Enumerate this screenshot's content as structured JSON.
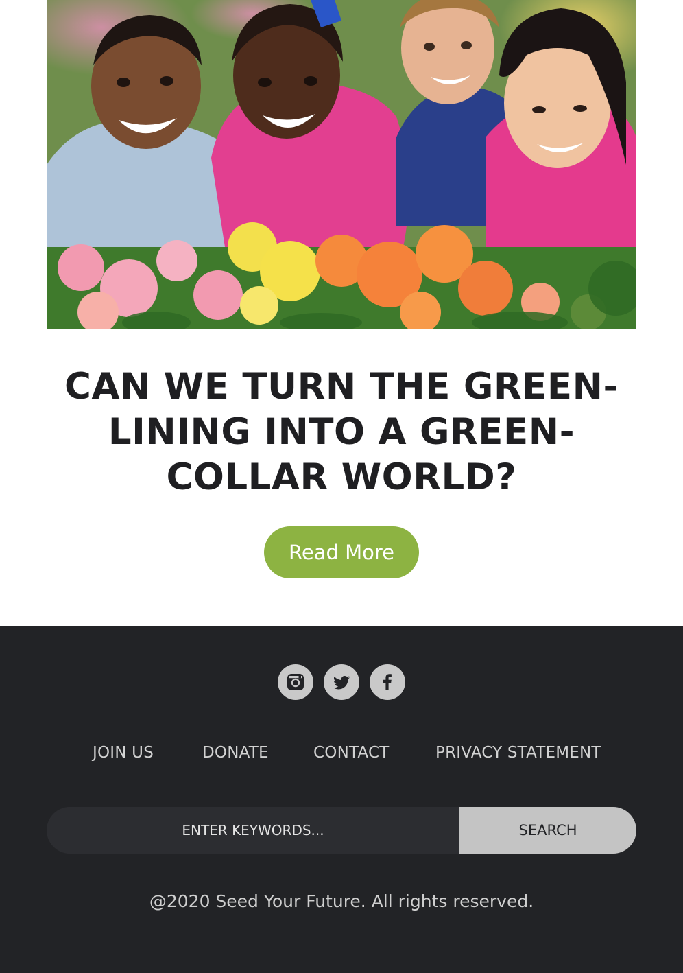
{
  "hero": {
    "image_alt": "Four smiling children leaning over flowering begonias"
  },
  "article": {
    "title": "CAN WE TURN THE GREEN-LINING INTO A GREEN-COLLAR WORLD?",
    "read_more_label": "Read More"
  },
  "footer": {
    "social": [
      {
        "icon": "instagram-icon"
      },
      {
        "icon": "twitter-icon"
      },
      {
        "icon": "facebook-icon"
      }
    ],
    "nav": [
      {
        "label": "JOIN US"
      },
      {
        "label": "DONATE"
      },
      {
        "label": "CONTACT"
      },
      {
        "label": "PRIVACY STATEMENT"
      }
    ],
    "search": {
      "placeholder": "ENTER KEYWORDS...",
      "button_label": "SEARCH"
    },
    "copyright": "@2020 Seed Your Future. All rights reserved."
  },
  "colors": {
    "accent_green": "#8db342",
    "footer_background": "#222326",
    "social_circle": "#c9c9c9",
    "search_button": "#c4c4c4",
    "title_text": "#1f1f22"
  }
}
